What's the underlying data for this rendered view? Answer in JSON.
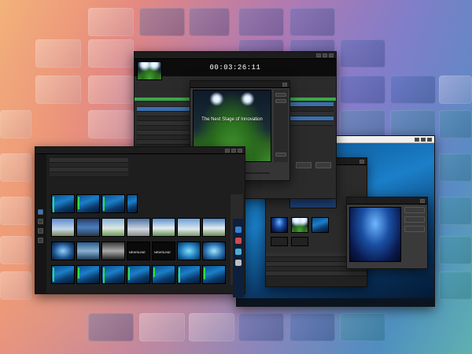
{
  "player": {
    "timecode": "00:03:26:11",
    "overlay_text": "The Next Stage of Innovation"
  },
  "switcher": {
    "labels": [
      "NEWSLINE",
      "NEWSLINE"
    ]
  },
  "colors": {
    "accent_green": "#3ca84a",
    "selection_blue": "#3a6fae",
    "window_bg": "#2b2b2b"
  },
  "icons": [
    "play-icon",
    "stop-icon",
    "rewind-icon",
    "fast-forward-icon",
    "window-close-icon",
    "audio-meter-icon"
  ]
}
